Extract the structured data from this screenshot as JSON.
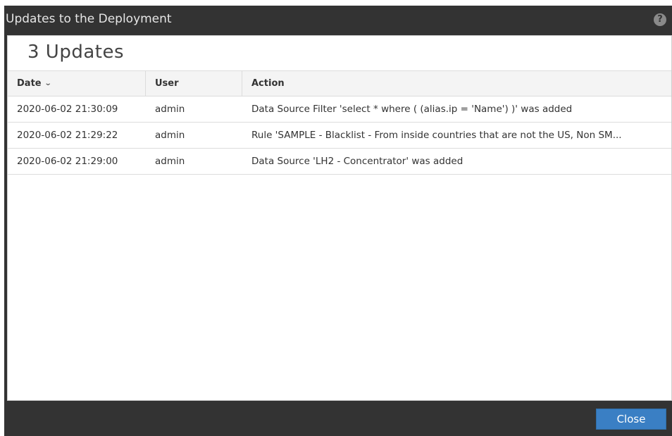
{
  "dialog": {
    "title": "Updates to the Deployment",
    "help_icon": "help-icon",
    "help_glyph": "?",
    "close_glyph": "✕"
  },
  "summary": {
    "count_label": "3 Updates"
  },
  "table": {
    "columns": [
      {
        "label": "Date",
        "sort": "chevron-down-icon"
      },
      {
        "label": "User"
      },
      {
        "label": "Action"
      }
    ],
    "sort_glyph": "⌄",
    "rows": [
      {
        "date": "2020-06-02 21:30:09",
        "user": "admin",
        "action": "Data Source Filter 'select * where ( (alias.ip = 'Name') )' was added"
      },
      {
        "date": "2020-06-02 21:29:22",
        "user": "admin",
        "action": "Rule 'SAMPLE - Blacklist - From inside countries that are not the US, Non SM..."
      },
      {
        "date": "2020-06-02 21:29:00",
        "user": "admin",
        "action": "Data Source 'LH2 - Concentrator' was added"
      }
    ]
  },
  "footer": {
    "close_label": "Close"
  },
  "colors": {
    "chrome": "#333333",
    "primary_button": "#3a7fc4"
  }
}
